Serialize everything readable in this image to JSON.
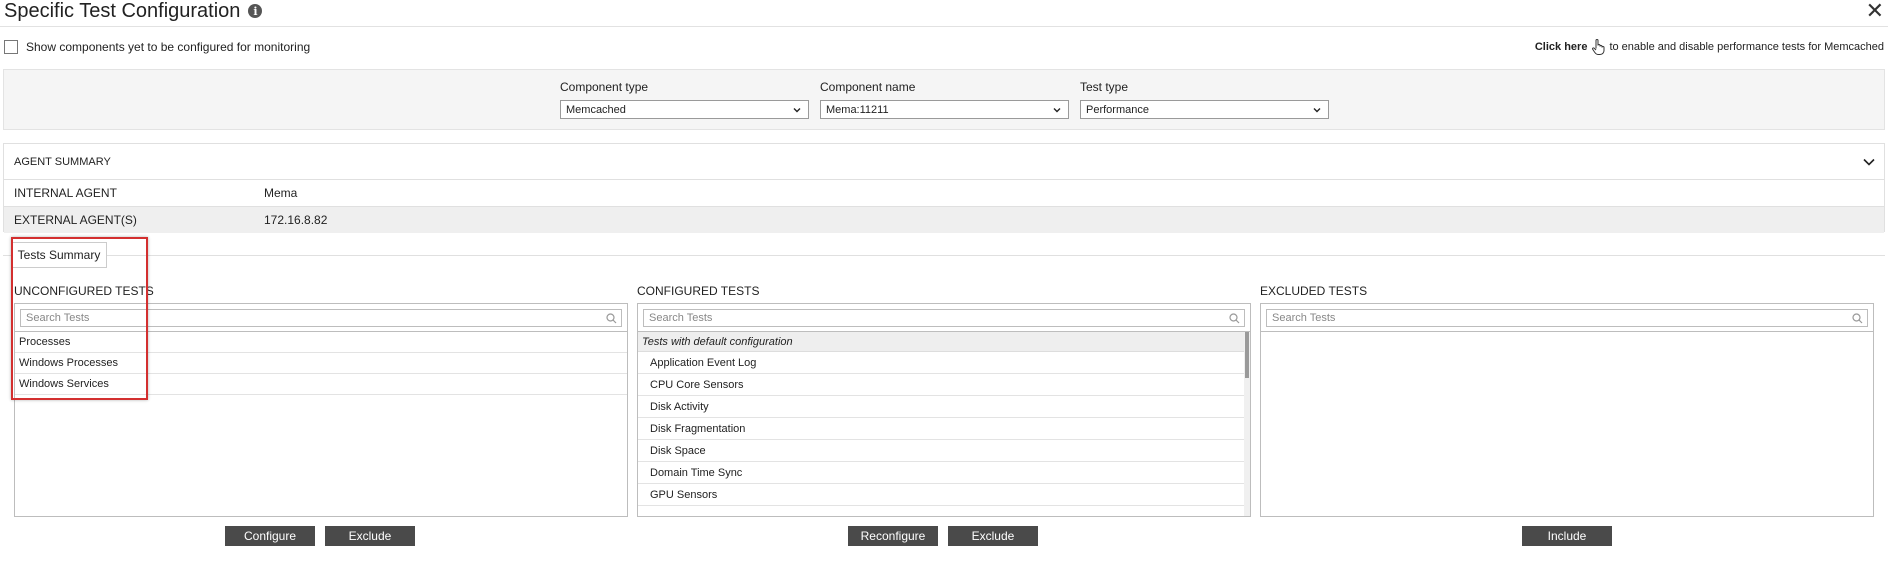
{
  "header": {
    "title": "Specific Test Configuration",
    "close": "✕"
  },
  "options": {
    "show_unconfigured_label": "Show components yet to be configured for monitoring",
    "click_here": "Click here",
    "click_here_suffix": "to enable and disable performance tests for Memcached"
  },
  "filters": {
    "component_type": {
      "label": "Component type",
      "value": "Memcached"
    },
    "component_name": {
      "label": "Component name",
      "value": "Mema:11211"
    },
    "test_type": {
      "label": "Test type",
      "value": "Performance"
    }
  },
  "agent_summary": {
    "title": "AGENT SUMMARY",
    "rows": [
      {
        "key": "INTERNAL AGENT",
        "value": "Mema"
      },
      {
        "key": "EXTERNAL AGENT(S)",
        "value": "172.16.8.82"
      }
    ]
  },
  "tests_summary": {
    "tab": "Tests Summary",
    "unconfigured": {
      "title": "UNCONFIGURED TESTS",
      "search_placeholder": "Search Tests",
      "items": [
        "Processes",
        "Windows Processes",
        "Windows Services"
      ],
      "buttons": {
        "configure": "Configure",
        "exclude": "Exclude"
      }
    },
    "configured": {
      "title": "CONFIGURED TESTS",
      "search_placeholder": "Search Tests",
      "group": "Tests with default configuration",
      "items": [
        "Application Event Log",
        "CPU Core Sensors",
        "Disk Activity",
        "Disk Fragmentation",
        "Disk Space",
        "Domain Time Sync",
        "GPU Sensors"
      ],
      "buttons": {
        "reconfigure": "Reconfigure",
        "exclude": "Exclude"
      }
    },
    "excluded": {
      "title": "EXCLUDED TESTS",
      "search_placeholder": "Search Tests",
      "buttons": {
        "include": "Include"
      }
    }
  }
}
